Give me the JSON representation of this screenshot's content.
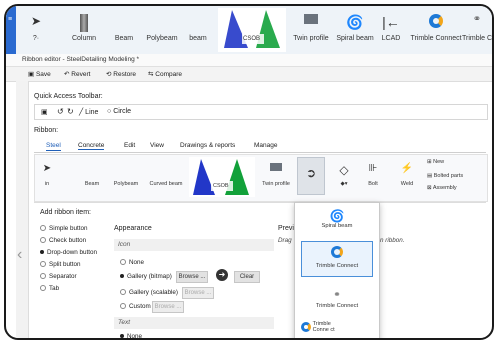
{
  "main_toolbar": {
    "items": [
      {
        "label": "Column"
      },
      {
        "label": "Beam"
      },
      {
        "label": "Polybeam"
      },
      {
        "label": "beam"
      },
      {
        "label": "CSOB"
      },
      {
        "label": "Twin profile"
      },
      {
        "label": "Spiral beam"
      },
      {
        "label": "LCAD"
      },
      {
        "label": "Trimble Connect"
      },
      {
        "label": "Trimble C"
      }
    ]
  },
  "editor": {
    "title": "Ribbon editor - SteelDetailing Modeling *",
    "toolbar": {
      "save": "Save",
      "revert": "Revert",
      "restore": "Restore",
      "compare": "Compare"
    }
  },
  "qat": {
    "label": "Quick Access Toolbar:",
    "items": [
      "Line",
      "Circle"
    ]
  },
  "ribbon": {
    "label": "Ribbon:",
    "tabs": [
      "Steel",
      "Concrete",
      "Edit",
      "View",
      "Drawings & reports",
      "Manage"
    ],
    "active_tab": "Steel",
    "tools": [
      {
        "label": "in"
      },
      {
        "label": "Beam"
      },
      {
        "label": "Polybeam"
      },
      {
        "label": "Curved beam"
      },
      {
        "label": "CSOB"
      },
      {
        "label": "Twin profile"
      },
      {
        "label": "Bolt"
      },
      {
        "label": "Weld"
      }
    ],
    "right_items": [
      "New",
      "Bolted parts",
      "Assembly"
    ]
  },
  "add_item": {
    "title": "Add ribbon item:",
    "types": [
      {
        "label": "Simple button",
        "selected": false
      },
      {
        "label": "Check button",
        "selected": false
      },
      {
        "label": "Drop-down button",
        "selected": true
      },
      {
        "label": "Split button",
        "selected": false
      },
      {
        "label": "Separator",
        "selected": false
      },
      {
        "label": "Tab",
        "selected": false
      }
    ]
  },
  "appearance": {
    "title": "Appearance",
    "icon_header": "Icon",
    "icon_options": [
      {
        "label": "None",
        "selected": false
      },
      {
        "label": "Gallery (bitmap)",
        "selected": true
      },
      {
        "label": "Gallery (scalable)",
        "selected": false
      },
      {
        "label": "Custom",
        "selected": false
      }
    ],
    "browse_label": "Browse ...",
    "clear_label": "Clear",
    "text_header": "Text",
    "text_options": [
      {
        "label": "None",
        "selected": true
      }
    ]
  },
  "preview": {
    "title": "Previ",
    "hint": "Drag",
    "hint_right": "n ribbon."
  },
  "popup": {
    "items": [
      {
        "label": "Spiral beam"
      },
      {
        "label": "Trimble Connect",
        "selected": true
      },
      {
        "label": "Trimble Connect"
      },
      {
        "label": "Trimble Conne ct"
      }
    ]
  },
  "colors": {
    "accent": "#1f5fb8",
    "title_strip": "#2a6ad0",
    "cone_blue": "#2237c8",
    "cone_green": "#12a13a"
  }
}
